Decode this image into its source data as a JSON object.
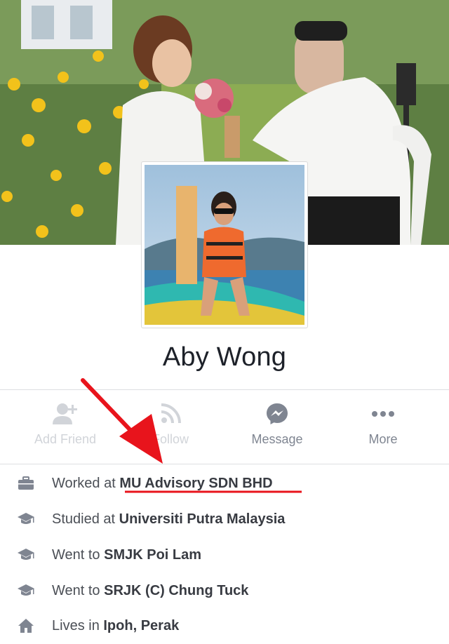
{
  "profile": {
    "name": "Aby Wong"
  },
  "actions": [
    {
      "label": "Add Friend",
      "icon": "add-friend-icon",
      "enabled": false
    },
    {
      "label": "Follow",
      "icon": "rss-icon",
      "enabled": false
    },
    {
      "label": "Message",
      "icon": "messenger-icon",
      "enabled": true
    },
    {
      "label": "More",
      "icon": "more-dots-icon",
      "enabled": true
    }
  ],
  "about": [
    {
      "icon": "briefcase-icon",
      "prefix": "Worked at ",
      "value": "MU Advisory SDN BHD"
    },
    {
      "icon": "graduation-cap-icon",
      "prefix": "Studied at ",
      "value": "Universiti Putra Malaysia"
    },
    {
      "icon": "graduation-cap-icon",
      "prefix": "Went to ",
      "value": "SMJK Poi Lam"
    },
    {
      "icon": "graduation-cap-icon",
      "prefix": "Went to ",
      "value": "SRJK (C) Chung Tuck"
    },
    {
      "icon": "house-icon",
      "prefix": "Lives in ",
      "value": "Ipoh, Perak"
    }
  ],
  "colors": {
    "annotation": "#e8141c",
    "icon_gray": "#7f8591",
    "disabled": "#d1d4d9",
    "text": "#1d2129"
  }
}
